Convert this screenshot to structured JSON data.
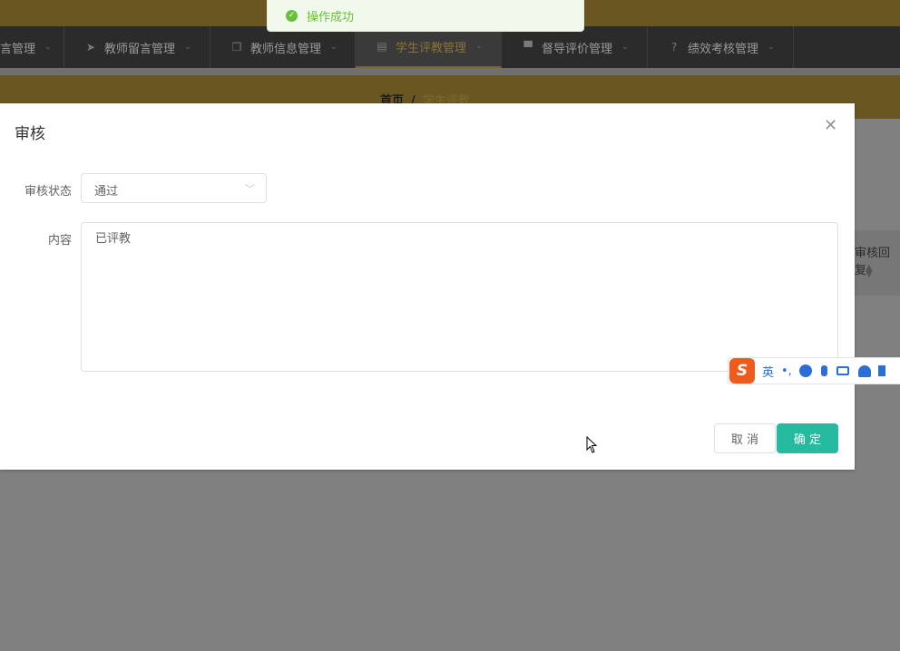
{
  "nav": {
    "items": [
      {
        "label": "言管理",
        "icon": "list-icon"
      },
      {
        "label": "教师留言管理",
        "icon": "send-icon"
      },
      {
        "label": "教师信息管理",
        "icon": "copy-icon"
      },
      {
        "label": "学生评教管理",
        "icon": "clipboard-icon",
        "active": true
      },
      {
        "label": "督导评价管理",
        "icon": "monitor-icon"
      },
      {
        "label": "绩效考核管理",
        "icon": "help-circle-icon"
      }
    ]
  },
  "breadcrumb": {
    "home": "首页",
    "separator": "/",
    "current": "学生评教"
  },
  "table": {
    "visible_header": "审核回复"
  },
  "toast": {
    "message": "操作成功",
    "type": "success"
  },
  "dialog": {
    "title": "审核",
    "status_label": "审核状态",
    "status_value": "通过",
    "content_label": "内容",
    "content_value": "已评教",
    "cancel_label": "取 消",
    "confirm_label": "确 定"
  },
  "ime": {
    "mode": "英",
    "punct": "•,"
  },
  "colors": {
    "accent": "#26bba0",
    "success": "#67c23a",
    "navbar": "#2b2b2b",
    "topbar": "#6a5620"
  }
}
